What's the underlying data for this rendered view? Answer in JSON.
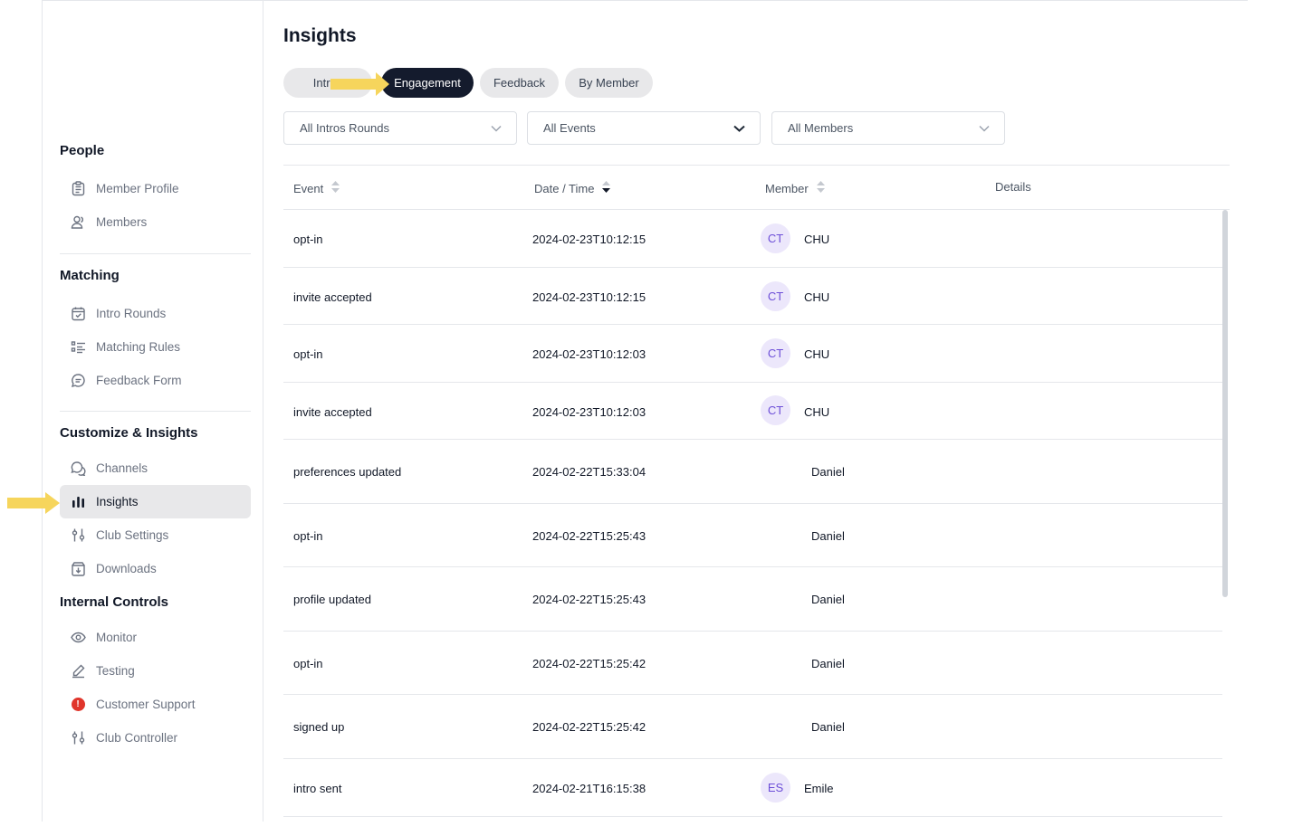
{
  "sidebar": {
    "sections": [
      {
        "title": "People",
        "items": [
          {
            "label": "Member Profile",
            "icon": "clipboard-icon"
          },
          {
            "label": "Members",
            "icon": "users-icon"
          }
        ]
      },
      {
        "title": "Matching",
        "items": [
          {
            "label": "Intro Rounds",
            "icon": "calendar-check-icon"
          },
          {
            "label": "Matching Rules",
            "icon": "list-icon"
          },
          {
            "label": "Feedback Form",
            "icon": "message-icon"
          }
        ]
      },
      {
        "title": "Customize & Insights",
        "items": [
          {
            "label": "Channels",
            "icon": "chat-bubbles-icon"
          },
          {
            "label": "Insights",
            "icon": "bar-chart-icon"
          },
          {
            "label": "Club Settings",
            "icon": "sliders-icon"
          },
          {
            "label": "Downloads",
            "icon": "download-box-icon"
          }
        ]
      },
      {
        "title": "Internal Controls",
        "items": [
          {
            "label": "Monitor",
            "icon": "eye-icon"
          },
          {
            "label": "Testing",
            "icon": "pencil-icon"
          },
          {
            "label": "Customer Support",
            "icon": "alert-icon",
            "badge": "!"
          },
          {
            "label": "Club Controller",
            "icon": "sliders-icon"
          }
        ]
      }
    ],
    "active_item": "Insights"
  },
  "page": {
    "title": "Insights",
    "tabs": [
      {
        "label": "Intros"
      },
      {
        "label": "Engagement"
      },
      {
        "label": "Feedback"
      },
      {
        "label": "By Member"
      }
    ],
    "active_tab": "Engagement"
  },
  "filters": [
    {
      "value": "All Intros Rounds"
    },
    {
      "value": "All Events"
    },
    {
      "value": "All Members"
    }
  ],
  "table": {
    "columns": [
      "Event",
      "Date / Time",
      "Member",
      "Details"
    ],
    "rows": [
      {
        "event": "opt-in",
        "datetime": "2024-02-23T10:12:15",
        "initials": "CT",
        "member": "CHU",
        "details": ""
      },
      {
        "event": "invite accepted",
        "datetime": "2024-02-23T10:12:15",
        "initials": "CT",
        "member": "CHU",
        "details": ""
      },
      {
        "event": "opt-in",
        "datetime": "2024-02-23T10:12:03",
        "initials": "CT",
        "member": "CHU",
        "details": ""
      },
      {
        "event": "invite accepted",
        "datetime": "2024-02-23T10:12:03",
        "initials": "CT",
        "member": "CHU",
        "details": ""
      },
      {
        "event": "preferences updated",
        "datetime": "2024-02-22T15:33:04",
        "initials": "",
        "member": "Daniel",
        "details": ""
      },
      {
        "event": "opt-in",
        "datetime": "2024-02-22T15:25:43",
        "initials": "",
        "member": "Daniel",
        "details": ""
      },
      {
        "event": "profile updated",
        "datetime": "2024-02-22T15:25:43",
        "initials": "",
        "member": "Daniel",
        "details": ""
      },
      {
        "event": "opt-in",
        "datetime": "2024-02-22T15:25:42",
        "initials": "",
        "member": "Daniel",
        "details": ""
      },
      {
        "event": "signed up",
        "datetime": "2024-02-22T15:25:42",
        "initials": "",
        "member": "Daniel",
        "details": ""
      },
      {
        "event": "intro sent",
        "datetime": "2024-02-21T16:15:38",
        "initials": "ES",
        "member": "Emile",
        "details": ""
      }
    ]
  },
  "colors": {
    "accent_dark": "#141b2d",
    "highlight_arrow": "#f6d55c",
    "avatar_bg": "#ece7fb",
    "avatar_text": "#6d4fd8",
    "alert": "#e0352b"
  }
}
